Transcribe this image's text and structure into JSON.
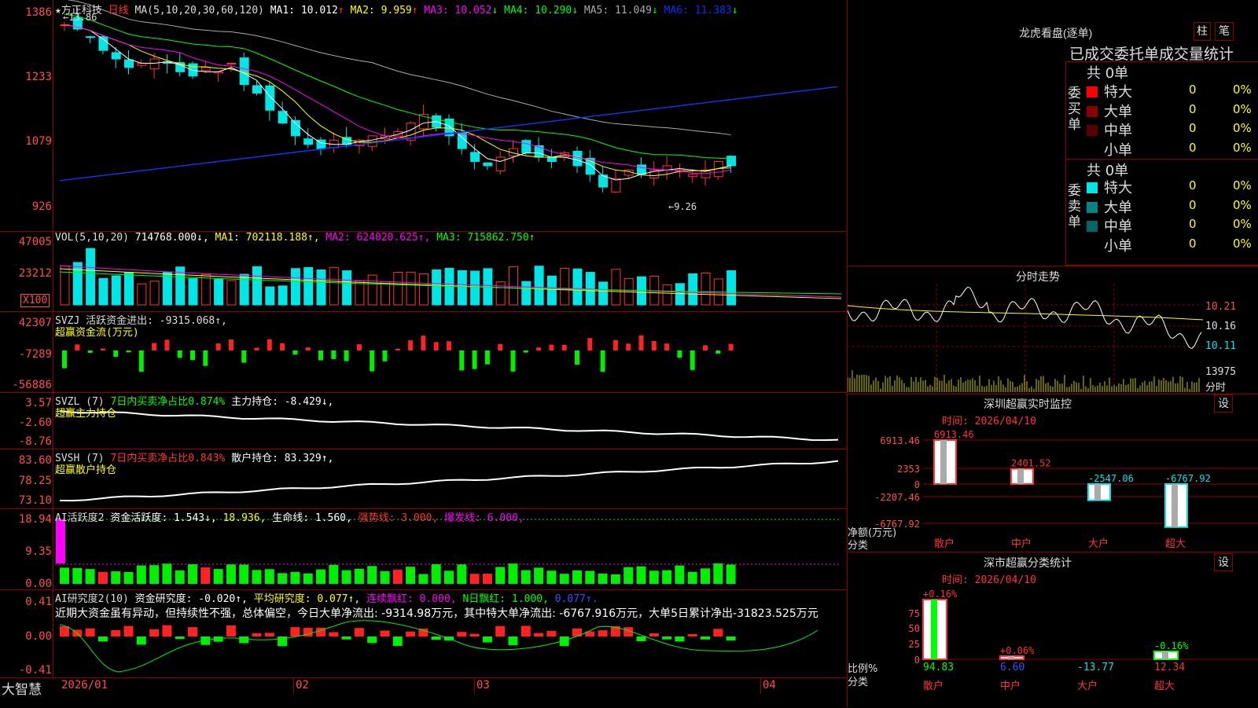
{
  "header": {
    "stock": "★方正科技",
    "period": "日线",
    "ma_params": "MA(5,10,20,30,60,120)",
    "ma": [
      {
        "label": "MA1: ",
        "value": "10.012",
        "dir": "↑",
        "color": "#ffffff"
      },
      {
        "label": "MA2: ",
        "value": "9.959",
        "dir": "↑",
        "color": "#ffff00"
      },
      {
        "label": "MA3: ",
        "value": "10.052",
        "dir": "↓",
        "color": "#ff00ff"
      },
      {
        "label": "MA4: ",
        "value": "10.290",
        "dir": "↓",
        "color": "#00ff00"
      },
      {
        "label": "MA5: ",
        "value": "11.049",
        "dir": "↓",
        "color": "#aaaaaa"
      },
      {
        "label": "MA6: ",
        "value": "11.383",
        "dir": "↓",
        "color": "#0033ff"
      }
    ]
  },
  "axes": {
    "price_ticks": [
      "1386",
      "1233",
      "1079",
      "926"
    ],
    "price_high_note": "13.86",
    "price_low_note": "9.26",
    "vol_ticks": [
      "47005",
      "23212"
    ],
    "vol_unit": "X100",
    "svzj_ticks": [
      "42307",
      "-7289",
      "-56886"
    ],
    "svzl_ticks": [
      "3.57",
      "-2.60",
      "-8.76"
    ],
    "svsh_ticks": [
      "83.60",
      "78.25",
      "73.10"
    ],
    "ai_ticks": [
      "18.94",
      "9.35",
      "0.00"
    ],
    "ai2_ticks": [
      "0.41",
      "0.00",
      "-0.41"
    ],
    "date_labels": [
      "2026/01",
      "02",
      "03",
      "04"
    ],
    "brand": "大智慧"
  },
  "indicators": {
    "vol": "VOL(5,10,20)  714768.000↓, MA1: 702118.188↑, MA2: 624020.625↑, MA3: 715862.750↑",
    "vol_parts": [
      {
        "t": "VOL(5,10,20) ",
        "c": "#dddddd"
      },
      {
        "t": "714768.000↓, ",
        "c": "#ffffff"
      },
      {
        "t": "MA1: 702118.188↑, ",
        "c": "#ffff00"
      },
      {
        "t": "MA2: 624020.625↑, ",
        "c": "#ff00ff"
      },
      {
        "t": "MA3: 715862.750↑",
        "c": "#00ff00"
      }
    ],
    "svzj_1": "SVZJ  活跃资金进出: -9315.068↑,",
    "svzj_2": "超赢资金流(万元)",
    "svzl_parts": [
      {
        "t": "SVZL (7) ",
        "c": "#dddddd"
      },
      {
        "t": "7日内买卖净占比0.874% ",
        "c": "#00ff00"
      },
      {
        "t": "主力持仓: -8.429↓,",
        "c": "#ffffff"
      }
    ],
    "svzl_2": "超赢主力持仓",
    "svsh_parts": [
      {
        "t": "SVSH (7) ",
        "c": "#dddddd"
      },
      {
        "t": "7日内买卖净占比0.843% ",
        "c": "#ff3333"
      },
      {
        "t": "散户持仓: 83.329↑,",
        "c": "#ffffff"
      }
    ],
    "svsh_2": "超赢散户持仓",
    "ai_parts": [
      {
        "t": "AI活跃度2 ",
        "c": "#dddddd"
      },
      {
        "t": "资金活跃度: 1.543↓, ",
        "c": "#ffffff"
      },
      {
        "t": "18.936, ",
        "c": "#ffff00"
      },
      {
        "t": "生命线: 1.560, ",
        "c": "#ffffff"
      },
      {
        "t": "强势线: 3.000, ",
        "c": "#ff3333"
      },
      {
        "t": "爆发线: 6.000,",
        "c": "#ff00ff"
      }
    ],
    "ai2_parts": [
      {
        "t": "AI研究度2(10) ",
        "c": "#dddddd"
      },
      {
        "t": "资金研究度: -0.020↑, ",
        "c": "#ffffff"
      },
      {
        "t": "平均研究度: 0.077↑, ",
        "c": "#ffff00"
      },
      {
        "t": "连续飘红: 0.000, ",
        "c": "#ff00ff"
      },
      {
        "t": "N日飘红: 1.000, ",
        "c": "#00ff00"
      },
      {
        "t": "0.077↑.",
        "c": "#3355ff"
      }
    ],
    "ai2_text": "近期大资金虽有异动，但持续性不强，总体偏空，今日大单净流出: -9314.98万元，其中特大单净流出: -6767.916万元，大单5日累计净出-31823.525万元"
  },
  "right": {
    "dragon_title": "龙虎看盘(逐单)",
    "btn_bar": "柱",
    "btn_pen": "笔",
    "tabs": "已成交委托单成交量统计",
    "buy_total": "共 0单",
    "buy_side": "委买单",
    "sell_total": "共 0单",
    "sell_side": "委卖单",
    "buy_rows": [
      {
        "name": "特大",
        "n": "0",
        "p": "0%",
        "c": "#ff0000"
      },
      {
        "name": "大单",
        "n": "0",
        "p": "0%",
        "c": "#8b0000"
      },
      {
        "name": "中单",
        "n": "0",
        "p": "0%",
        "c": "#5a0000"
      },
      {
        "name": "小单",
        "n": "0",
        "p": "0%",
        "c": ""
      }
    ],
    "sell_rows": [
      {
        "name": "特大",
        "n": "0",
        "p": "0%",
        "c": "#00e5e5"
      },
      {
        "name": "大单",
        "n": "0",
        "p": "0%",
        "c": "#008888"
      },
      {
        "name": "中单",
        "n": "0",
        "p": "0%",
        "c": "#006666"
      },
      {
        "name": "小单",
        "n": "0",
        "p": "0%",
        "c": ""
      }
    ],
    "intraday_title": "分时走势",
    "intraday_ticks": [
      "10.21",
      "10.16",
      "10.11"
    ],
    "intraday_vol": "13975",
    "intraday_unit": "分时",
    "sz_title": "深圳超赢实时监控",
    "sz_btn": "设",
    "sz_time": "时间: 2026/04/10",
    "sz_ticks": [
      "6913.46",
      "2353",
      "0",
      "-2207.46",
      "-6767.92"
    ],
    "sz_ylabel": "净额(万元)",
    "sz_xlabel": "分类",
    "sz_bars": [
      {
        "cat": "散户",
        "value": "6913.46",
        "c": "#ff3333"
      },
      {
        "cat": "中户",
        "value": "2401.52",
        "c": "#ff3333"
      },
      {
        "cat": "大户",
        "value": "-2547.06",
        "c": "#00e5e5"
      },
      {
        "cat": "超大",
        "value": "-6767.92",
        "c": "#00e5e5"
      }
    ],
    "sh_title": "深市超赢分类统计",
    "sh_btn": "设",
    "sh_time": "时间: 2026/04/10",
    "sh_ticks": [
      "75",
      "50",
      "25",
      "0"
    ],
    "sh_ylabel": "比例%",
    "sh_xlabel": "分类",
    "sh_bars": [
      {
        "cat": "散户",
        "top": "+0.16%",
        "bottom": "94.83",
        "c": "#ff3333",
        "bc": "#00ff00"
      },
      {
        "cat": "中户",
        "top": "+0.06%",
        "bottom": "6.60",
        "c": "#ff3333",
        "bc": "#3355ff"
      },
      {
        "cat": "大户",
        "top": "",
        "bottom": "-13.77",
        "c": "#ff3333",
        "bc": "#00e5e5"
      },
      {
        "cat": "超大",
        "top": "-0.16%",
        "bottom": "12.34",
        "c": "#00ff00",
        "bc": "#ff3333"
      }
    ]
  },
  "chart_data": {
    "type": "line",
    "title": "方正科技 日线",
    "x": [
      "2026/01",
      "02",
      "03",
      "04"
    ],
    "price_high": 13.86,
    "price_low": 9.26,
    "ylim": [
      9.26,
      13.86
    ],
    "close_approx": [
      13.5,
      13.4,
      13.2,
      12.9,
      12.7,
      12.5,
      12.6,
      12.7,
      12.6,
      12.4,
      12.3,
      12.5,
      12.4,
      12.6,
      12.1,
      11.9,
      11.5,
      11.2,
      10.9,
      10.7,
      10.6,
      10.8,
      10.7,
      10.8,
      10.9,
      10.9,
      11.0,
      11.2,
      11.4,
      11.1,
      10.9,
      10.6,
      10.3,
      10.2,
      10.4,
      10.6,
      10.5,
      10.4,
      10.3,
      10.5,
      10.2,
      10.0,
      9.7,
      9.9,
      10.1,
      10.0,
      10.1,
      10.2,
      10.1,
      10.0,
      10.1,
      10.3,
      10.2
    ]
  }
}
